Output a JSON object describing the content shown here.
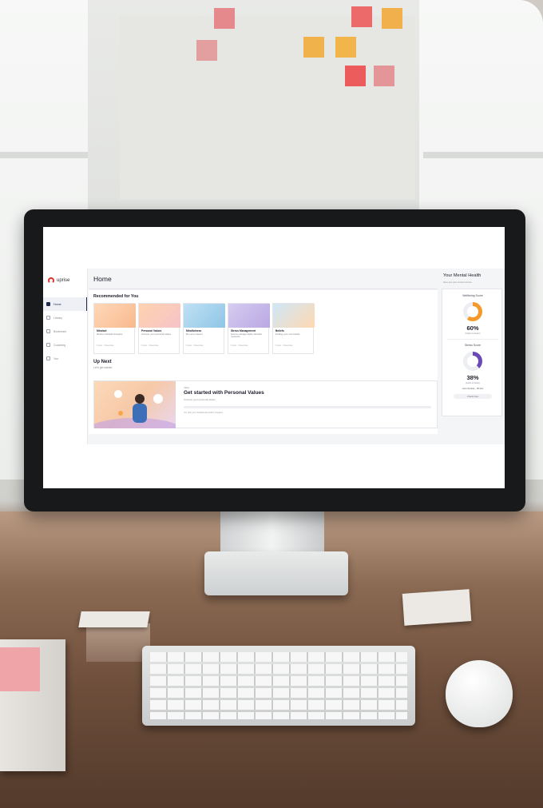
{
  "app": {
    "brand": "uprise",
    "page_title": "Home",
    "sidebar": {
      "items": [
        {
          "label": "Home",
          "active": true
        },
        {
          "label": "Library",
          "active": false
        },
        {
          "label": "Bookmark",
          "active": false
        },
        {
          "label": "Coaching",
          "active": false
        },
        {
          "label": "You",
          "active": false
        }
      ]
    },
    "recommended": {
      "title": "Recommended for You",
      "cards": [
        {
          "title": "Mindset",
          "desc": "Rewire unhelpful thoughts",
          "meta": "6 mins · 3 Exercises"
        },
        {
          "title": "Personal Values",
          "desc": "Uncover your personal values",
          "meta": "6 mins · 3 Exercises"
        },
        {
          "title": "Mindfulness",
          "desc": "Be more present",
          "meta": "6 mins · 3 Exercises"
        },
        {
          "title": "Stress Management",
          "desc": "How to manage highly stressful moments",
          "meta": "6 mins · 3 Exercises"
        },
        {
          "title": "Beliefs",
          "desc": "Finding your core beliefs",
          "meta": "6 mins · 3 Exercises"
        }
      ]
    },
    "up_next": {
      "title": "Up Next",
      "subtitle": "Let's get started",
      "kicker": "Video",
      "feature_title": "Get started with Personal Values",
      "feature_sub": "Uncover your personal values",
      "hint": "Tip: pick your headphones before it begins"
    },
    "mental_health": {
      "title": "Your Mental Health",
      "subtitle": "Here are your current scores",
      "wellbeing": {
        "label": "Wellbeing Score",
        "value": "60%",
        "note": "(higher is better)",
        "fraction": 0.6,
        "color": "#f39a2b"
      },
      "stress": {
        "label": "Stress Score",
        "value": "38%",
        "note": "(lower is better)",
        "fraction": 0.38,
        "color": "#6a4ab5"
      },
      "last_checked": "Last checked – 08 Dec",
      "button": "Check Now"
    }
  }
}
